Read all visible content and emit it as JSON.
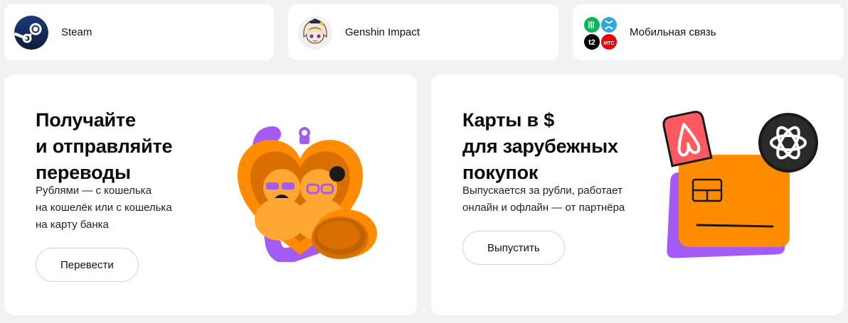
{
  "tiles": [
    {
      "label": "Steam",
      "icon": "steam-logo-icon"
    },
    {
      "label": "Genshin Impact",
      "icon": "genshin-character-icon"
    },
    {
      "label": "Мобильная связь",
      "icon": "mobile-operators-icon",
      "operators": [
        "t2",
        "МТС"
      ]
    }
  ],
  "cards": [
    {
      "title": "Получайте\nи отправляйте\nпереводы",
      "description": "Рублями — с кошелька\nна кошелёк или с кошелька\nна карту банка",
      "button": "Перевести",
      "illustration": "heart-locket-coin-illustration"
    },
    {
      "title": "Карты в $\nдля зарубежных\nпокупок",
      "description": "Выпускается за рубли, работает\nонлайн и офлайн — от партнёра",
      "button": "Выпустить",
      "illustration": "card-airbnb-openai-illustration"
    }
  ],
  "colors": {
    "orange": "#ff8c00",
    "dark_orange": "#d96f00",
    "purple": "#a45bf5",
    "airbnb_red": "#ff5a5f",
    "steam_blue": "#1b2a55",
    "background": "#f2f2f2"
  }
}
